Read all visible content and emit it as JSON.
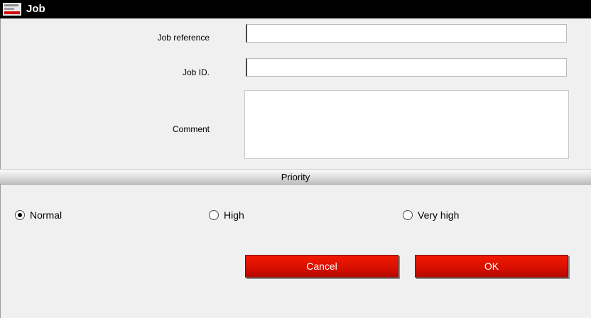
{
  "window": {
    "title": "Job"
  },
  "form": {
    "job_reference": {
      "label": "Job reference",
      "value": ""
    },
    "job_id": {
      "label": "Job ID.",
      "value": ""
    },
    "comment": {
      "label": "Comment",
      "value": ""
    }
  },
  "priority": {
    "title": "Priority",
    "options": [
      {
        "label": "Normal",
        "selected": true
      },
      {
        "label": "High",
        "selected": false
      },
      {
        "label": "Very high",
        "selected": false
      }
    ]
  },
  "buttons": {
    "cancel": "Cancel",
    "ok": "OK"
  },
  "colors": {
    "button": "#e01200",
    "titlebar": "#000000"
  }
}
